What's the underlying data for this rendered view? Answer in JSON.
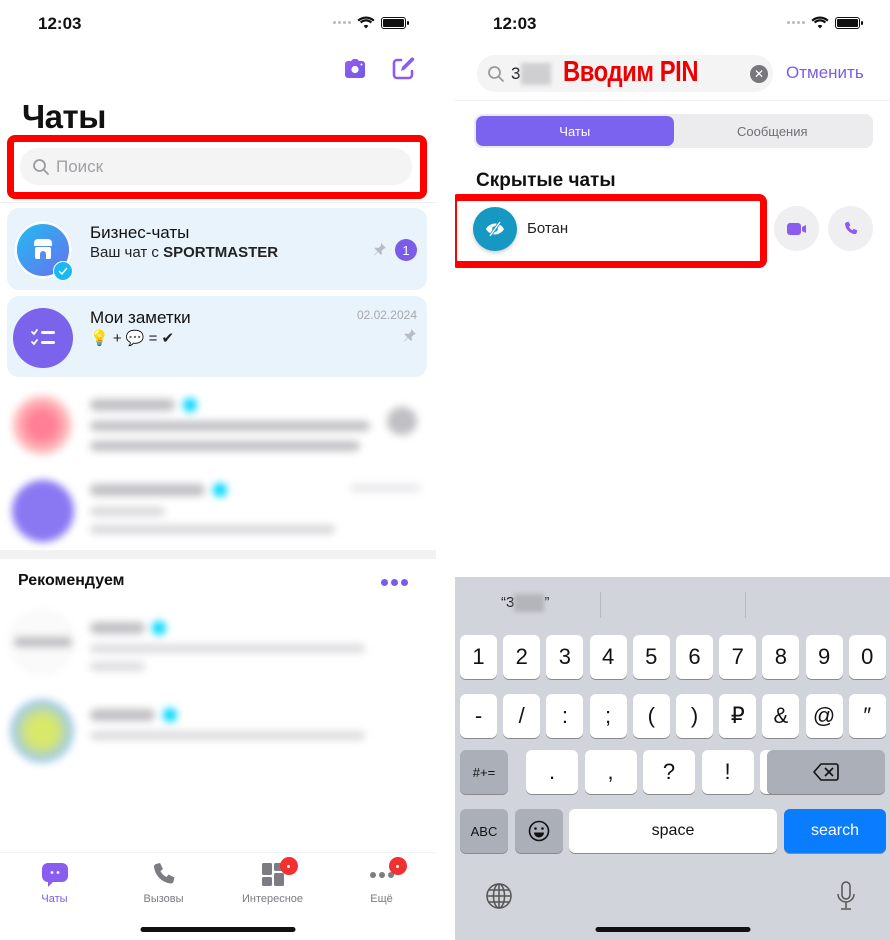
{
  "left_screen": {
    "status": {
      "time": "12:03"
    },
    "header": {
      "title": "Чаты",
      "camera_icon": "camera-icon",
      "compose_icon": "compose-icon"
    },
    "search": {
      "placeholder": "Поиск"
    },
    "chats": [
      {
        "name": "Бизнес-чаты",
        "subtitle_prefix": "Ваш чат с ",
        "subtitle_bold": "SPORTMASTER",
        "pinned": true,
        "unread": "1",
        "avatar": "business-store-icon"
      },
      {
        "name": "Мои заметки",
        "subtitle": "💡 + 💬 = ✔",
        "date": "02.02.2024",
        "pinned": true,
        "avatar": "notes-checklist-icon"
      }
    ],
    "recommended": {
      "title": "Рекомендуем",
      "more_icon": "more-dots-icon"
    },
    "tabbar": [
      {
        "label": "Чаты",
        "icon": "chat-bubble-icon",
        "active": true,
        "dot": false
      },
      {
        "label": "Вызовы",
        "icon": "phone-icon",
        "active": false,
        "dot": false
      },
      {
        "label": "Интересное",
        "icon": "grid-icon",
        "active": false,
        "dot": true
      },
      {
        "label": "Ещё",
        "icon": "more-icon",
        "active": false,
        "dot": true
      }
    ]
  },
  "right_screen": {
    "status": {
      "time": "12:03"
    },
    "search": {
      "value_visible": "3",
      "overlay_annotation": "Вводим PIN",
      "cancel_label": "Отменить"
    },
    "segments": [
      {
        "label": "Чаты",
        "active": true
      },
      {
        "label": "Сообщения",
        "active": false
      }
    ],
    "hidden_section": {
      "title": "Скрытые чаты",
      "items": [
        {
          "name": "Ботан",
          "avatar": "hidden-eye-icon"
        }
      ]
    },
    "keyboard": {
      "suggestion": "“3",
      "suggestion_close": "”",
      "row1": [
        "1",
        "2",
        "3",
        "4",
        "5",
        "6",
        "7",
        "8",
        "9",
        "0"
      ],
      "row2": [
        "-",
        "/",
        ":",
        ";",
        "(",
        ")",
        "₽",
        "&",
        "@",
        "″"
      ],
      "row3": [
        ".",
        ",",
        "?",
        "!",
        "′"
      ],
      "symbols_label": "#+=",
      "abc_label": "ABC",
      "space_label": "space",
      "search_label": "search"
    }
  },
  "colors": {
    "accent": "#7b5ce6",
    "annotation_red": "#ff0000",
    "search_key": "#0a7cff"
  }
}
